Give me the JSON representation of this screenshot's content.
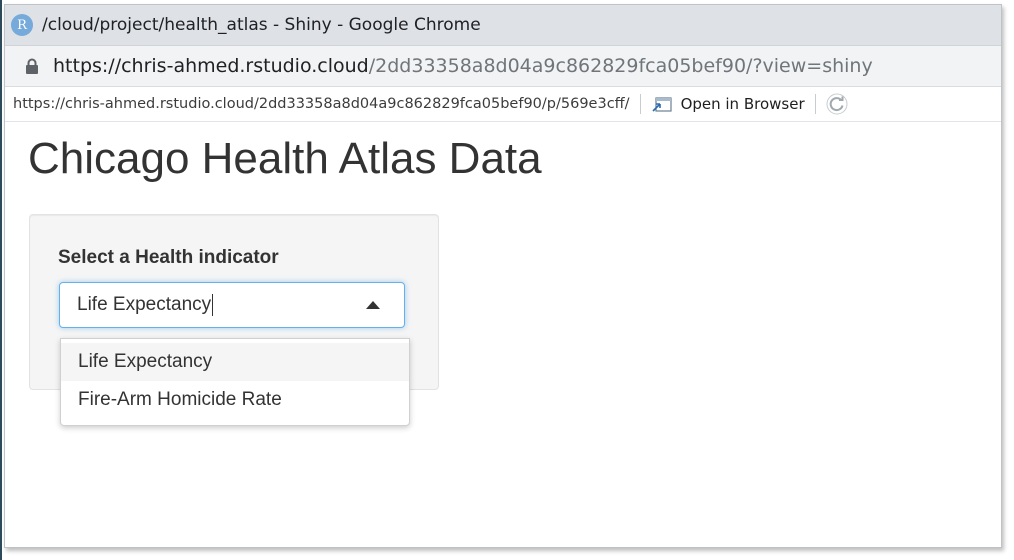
{
  "window": {
    "title": "/cloud/project/health_atlas - Shiny - Google Chrome",
    "app_icon_letter": "R"
  },
  "addressbar": {
    "url_host": "https://chris-ahmed.rstudio.cloud",
    "url_path": "/2dd33358a8d04a9c862829fca05bef90/?view=shiny"
  },
  "rstudio_bar": {
    "url": "https://chris-ahmed.rstudio.cloud/2dd33358a8d04a9c862829fca05bef90/p/569e3cff/",
    "open_in_browser_label": "Open in Browser"
  },
  "page": {
    "title": "Chicago Health Atlas Data",
    "select_label": "Select a Health indicator",
    "select_value": "Life Expectancy",
    "options": [
      {
        "label": "Life Expectancy"
      },
      {
        "label": "Fire-Arm Homicide Rate"
      }
    ]
  },
  "colors": {
    "focus_border": "#66afe9",
    "rstudio_blue": "#75aadb"
  }
}
